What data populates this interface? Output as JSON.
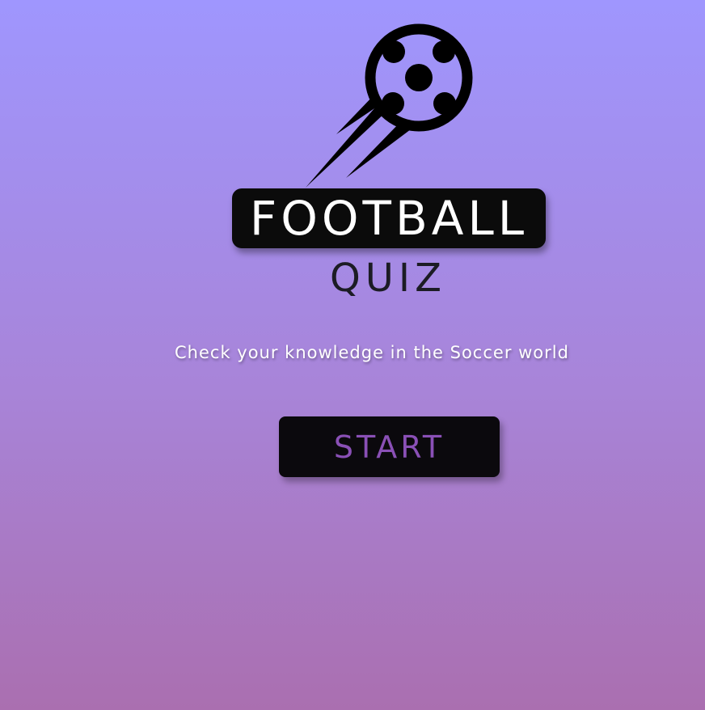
{
  "logo": {
    "icon": "soccer-ball-icon"
  },
  "title": {
    "main": "FOOTBALL",
    "sub": "QUIZ"
  },
  "tagline": "Check your knowledge in the Soccer world",
  "actions": {
    "start_label": "START"
  },
  "colors": {
    "background_top": "#9f96fe",
    "background_bottom": "#aa6fb0",
    "title_badge": "#0b0b0b",
    "start_button": "#0b090d",
    "start_label": "#8a50b6"
  }
}
